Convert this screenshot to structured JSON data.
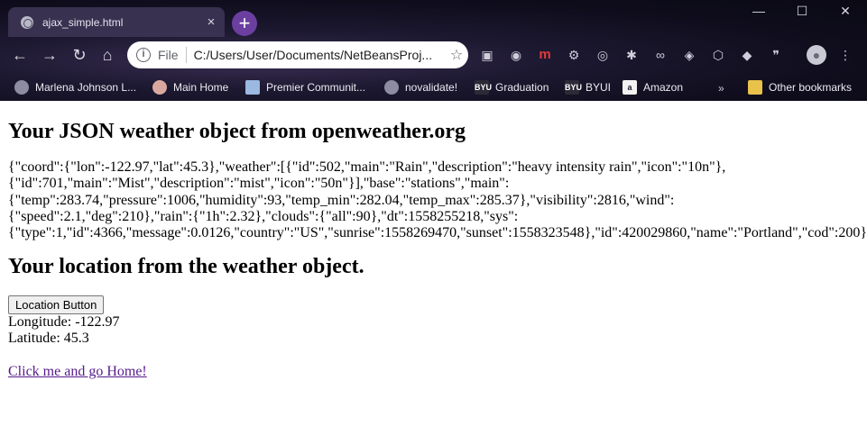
{
  "browser": {
    "tab": {
      "title": "ajax_simple.html",
      "close": "×"
    },
    "new_tab": "+",
    "window_controls": {
      "minimize": "—",
      "maximize": "☐",
      "close": "✕"
    },
    "nav": {
      "back": "←",
      "forward": "→",
      "reload": "↻",
      "home": "⌂"
    },
    "omnibox": {
      "info": "i",
      "scheme": "File",
      "url": "C:/Users/User/Documents/NetBeansProj...",
      "star": "☆"
    },
    "extensions": [
      {
        "icon": "briefcase-icon",
        "glyph": "▣"
      },
      {
        "icon": "circle-icon",
        "glyph": "◉"
      },
      {
        "icon": "m-logo-icon",
        "glyph": "m"
      },
      {
        "icon": "gear-icon",
        "glyph": "⚙"
      },
      {
        "icon": "wheel-icon",
        "glyph": "◎"
      },
      {
        "icon": "puzzle-icon",
        "glyph": "✱"
      },
      {
        "icon": "infinity-icon",
        "glyph": "∞"
      },
      {
        "icon": "shield-icon",
        "glyph": "◈"
      },
      {
        "icon": "pdf-icon",
        "glyph": "⬡"
      },
      {
        "icon": "cube-icon",
        "glyph": "◆"
      },
      {
        "icon": "quote-icon",
        "glyph": "❞"
      },
      {
        "icon": "dots-icon",
        "glyph": "⋮"
      }
    ],
    "menu": "⋮",
    "bookmarks": [
      {
        "label": "Marlena Johnson L...",
        "badge": ""
      },
      {
        "label": "Main Home",
        "badge": ""
      },
      {
        "label": "Premier Communit...",
        "badge": ""
      },
      {
        "label": "novalidate!",
        "badge": ""
      },
      {
        "label": "Graduation",
        "badge": "BYU"
      },
      {
        "label": "BYUI",
        "badge": "BYU"
      },
      {
        "label": "Amazon",
        "badge": "a"
      }
    ],
    "bookmarks_overflow": "»",
    "other_bookmarks": "Other bookmarks"
  },
  "page": {
    "heading1": "Your JSON weather object from openweather.org",
    "json_lines": [
      "{\"coord\":{\"lon\":-122.97,\"lat\":45.3},\"weather\":[{\"id\":502,\"main\":\"Rain\",\"description\":\"heavy intensity rain\",\"icon\":\"10n\"},",
      "{\"id\":701,\"main\":\"Mist\",\"description\":\"mist\",\"icon\":\"50n\"}],\"base\":\"stations\",\"main\":",
      "{\"temp\":283.74,\"pressure\":1006,\"humidity\":93,\"temp_min\":282.04,\"temp_max\":285.37},\"visibility\":2816,\"wind\":",
      "{\"speed\":2.1,\"deg\":210},\"rain\":{\"1h\":2.32},\"clouds\":{\"all\":90},\"dt\":1558255218,\"sys\":",
      "{\"type\":1,\"id\":4366,\"message\":0.0126,\"country\":\"US\",\"sunrise\":1558269470,\"sunset\":1558323548},\"id\":420029860,\"name\":\"Portland\",\"cod\":200}"
    ],
    "heading2": "Your location from the weather object.",
    "location_button": "Location Button",
    "longitude": "Longitude: -122.97",
    "latitude": "Latitude: 45.3",
    "home_link": "Click me and go Home!"
  }
}
